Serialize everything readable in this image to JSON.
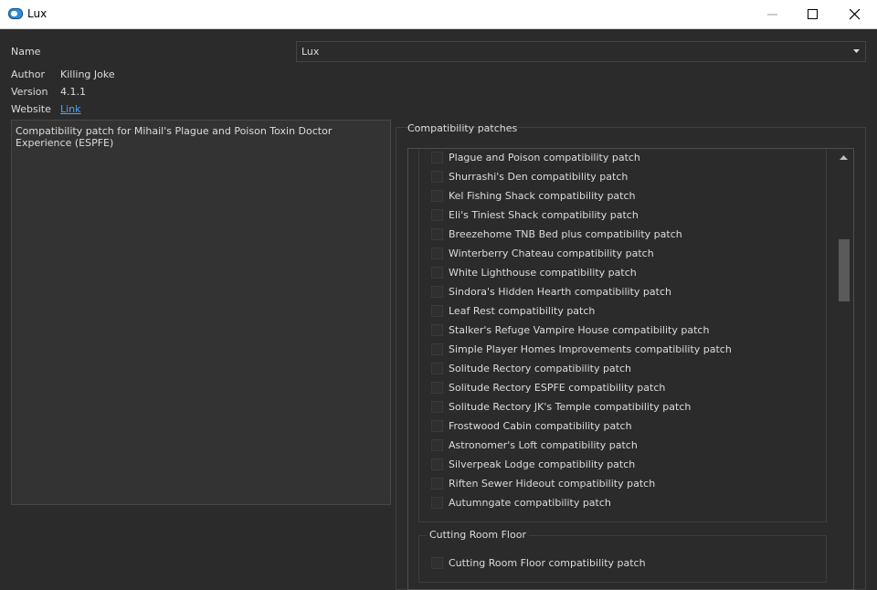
{
  "window": {
    "title": "Lux",
    "icon": "lux-app-icon"
  },
  "info": {
    "name_label": "Name",
    "name_value": "Lux",
    "author_label": "Author",
    "author_value": "Killing Joke",
    "version_label": "Version",
    "version_value": "4.1.1",
    "website_label": "Website",
    "website_link": "Link"
  },
  "description": "Compatibility patch for Mihail's Plague and Poison Toxin Doctor Experience (ESPFE)",
  "patches": {
    "group_title": "Compatibility patches",
    "items": [
      "Plague and Poison compatibility patch",
      "Shurrashi's Den compatibility patch",
      "Kel Fishing Shack compatibility patch",
      "Eli's Tiniest Shack compatibility patch",
      "Breezehome TNB Bed plus compatibility patch",
      "Winterberry Chateau compatibility patch",
      "White Lighthouse compatibility patch",
      "Sindora's Hidden Hearth compatibility patch",
      "Leaf Rest compatibility patch",
      "Stalker's Refuge Vampire House compatibility patch",
      "Simple Player Homes Improvements compatibility patch",
      "Solitude Rectory compatibility patch",
      "Solitude Rectory ESPFE compatibility patch",
      "Solitude Rectory JK's Temple compatibility patch",
      "Frostwood Cabin compatibility patch",
      "Astronomer's Loft compatibility patch",
      "Silverpeak Lodge compatibility patch",
      "Riften Sewer Hideout compatibility patch",
      "Autumngate compatibility patch"
    ],
    "subgroup_title": "Cutting Room Floor",
    "subgroup_items": [
      "Cutting Room Floor compatibility patch"
    ]
  },
  "colors": {
    "background": "#2b2b2b",
    "text": "#dcdcdc",
    "link": "#4aa3ff"
  }
}
